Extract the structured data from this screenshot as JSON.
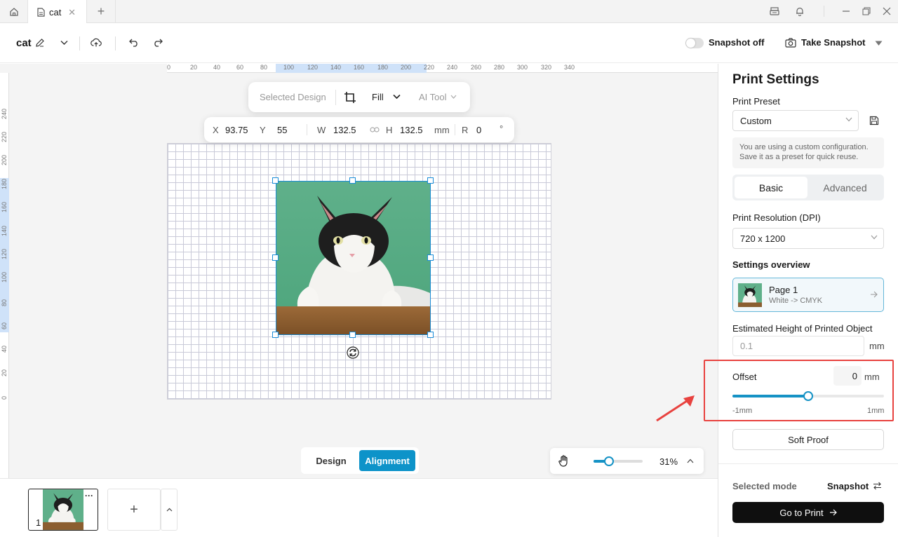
{
  "tabs": {
    "active_tab_label": "cat"
  },
  "toolbar": {
    "doc_title": "cat",
    "snapshot_toggle_label": "Snapshot off",
    "take_snapshot_label": "Take Snapshot"
  },
  "rulers": {
    "top_ticks": [
      "0",
      "20",
      "40",
      "60",
      "80",
      "100",
      "120",
      "140",
      "160",
      "180",
      "200",
      "220",
      "240",
      "260",
      "280",
      "300",
      "320",
      "340"
    ],
    "left_ticks": [
      "240",
      "220",
      "200",
      "180",
      "160",
      "140",
      "120",
      "100",
      "80",
      "60",
      "40",
      "20",
      "0"
    ]
  },
  "selection_toolbar": {
    "selected_design_label": "Selected Design",
    "fill_label": "Fill",
    "ai_tool_label": "AI Tool"
  },
  "coords": {
    "x_label": "X",
    "x_value": "93.75",
    "y_label": "Y",
    "y_value": "55",
    "w_label": "W",
    "w_value": "132.5",
    "h_label": "H",
    "h_value": "132.5",
    "unit": "mm",
    "r_label": "R",
    "r_value": "0",
    "degree": "°"
  },
  "mode_tabs": {
    "design_label": "Design",
    "alignment_label": "Alignment"
  },
  "zoom": {
    "level_label": "31%",
    "level": 0.31
  },
  "pages": {
    "page_number": "1",
    "more_label": "···"
  },
  "print_settings": {
    "title": "Print Settings",
    "preset_label": "Print Preset",
    "preset_value": "Custom",
    "preset_info": "You are using a custom configuration. Save it as a preset for quick reuse.",
    "basic_tab": "Basic",
    "advanced_tab": "Advanced",
    "resolution_label": "Print Resolution (DPI)",
    "resolution_value": "720 x 1200",
    "overview_label": "Settings overview",
    "page_card_title": "Page 1",
    "page_card_sub": "White -> CMYK",
    "height_label": "Estimated Height of Printed Object",
    "height_placeholder": "0.1",
    "height_unit": "mm",
    "offset_label": "Offset",
    "offset_value": "0",
    "offset_unit": "mm",
    "offset_min": "-1mm",
    "offset_max": "1mm",
    "offset_fraction": 0.5,
    "soft_proof_label": "Soft Proof",
    "selected_mode_label": "Selected mode",
    "selected_mode_value": "Snapshot",
    "go_to_print_label": "Go to Print"
  },
  "colors": {
    "accent": "#1592c5",
    "alignment_button": "#0d93c9",
    "selection": "#1a8cd8",
    "highlight_red": "#e8423f",
    "print_button": "#0f0f0f"
  },
  "icons": {
    "home": "home-icon",
    "doc": "document-icon",
    "edit": "edit-icon",
    "upload": "cloud-upload-icon",
    "undo": "undo-icon",
    "redo": "redo-icon",
    "camera": "camera-icon",
    "crop": "crop-icon",
    "rotate": "rotate-icon",
    "hand": "hand-icon",
    "save": "save-icon",
    "swap": "swap-icon",
    "arrow": "arrow-right-icon"
  }
}
